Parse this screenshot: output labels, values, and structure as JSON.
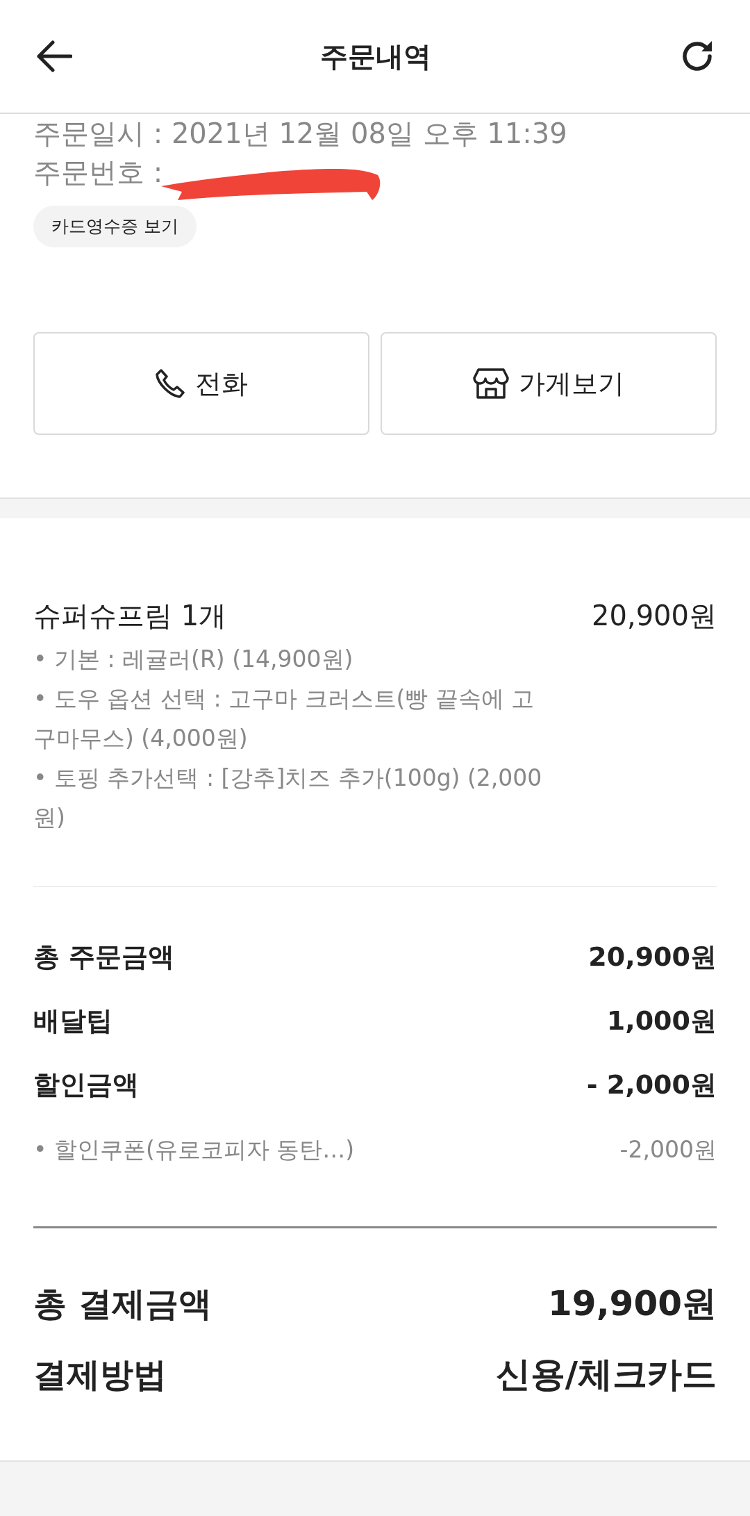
{
  "header": {
    "title": "주문내역"
  },
  "order": {
    "date": "주문일시 : 2021년 12월 08일 오후 11:39",
    "number_label": "주문번호 :",
    "receipt_button": "카드영수증 보기"
  },
  "actions": [
    {
      "kind": "phone",
      "label": "전화"
    },
    {
      "kind": "store",
      "label": "가게보기"
    }
  ],
  "item": {
    "name": "슈퍼슈프림 1개",
    "price": "20,900원",
    "options": [
      "• 기본 : 레귤러(R) (14,900원)",
      "• 도우 옵션 선택 : 고구마 크러스트(빵 끝속에 고구마무스) (4,000원)",
      "• 토핑 추가선택 : [강추]치즈 추가(100g) (2,000원)"
    ]
  },
  "summary": [
    {
      "label": "총 주문금액",
      "value": "20,900원"
    },
    {
      "label": "배달팁",
      "value": "1,000원"
    },
    {
      "label": "할인금액",
      "value": "- 2,000원"
    }
  ],
  "discounts": [
    {
      "label": "• 할인쿠폰(유로코피자 동탄…)",
      "value": "-2,000원"
    }
  ],
  "payment": [
    {
      "label": "총 결제금액",
      "value": "19,900원"
    },
    {
      "label": "결제방법",
      "value": "신용/체크카드"
    }
  ]
}
